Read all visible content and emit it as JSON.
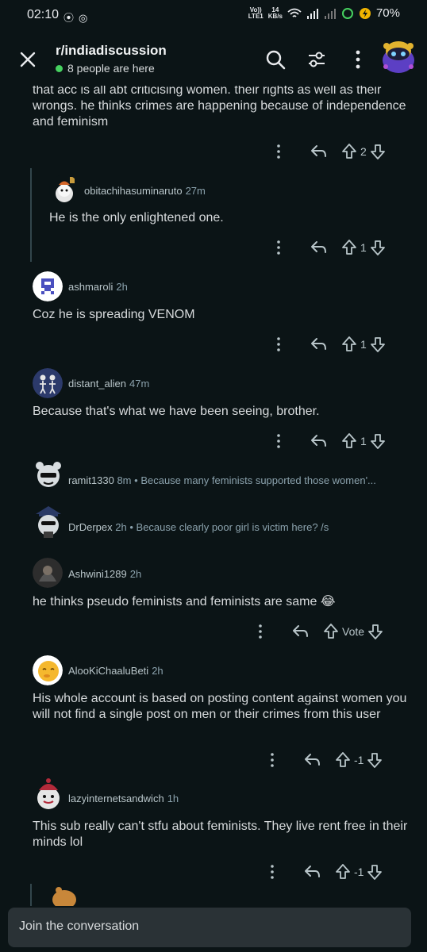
{
  "status_bar": {
    "time": "02:10",
    "net_top": "Vo))",
    "net_bottom": "LTE1",
    "speed_top": "14",
    "speed_bottom": "KB/s",
    "battery": "70%"
  },
  "header": {
    "subreddit": "r/indiadiscussion",
    "online": "8 people are here"
  },
  "parent_snippet": {
    "text": "that acc is all abt criticising women. their rights as well as their wrongs. he thinks crimes are happening because of independence and feminism",
    "votes": "2"
  },
  "comments": [
    {
      "user": "obitachihasuminaruto",
      "age": "27m",
      "text": "He is the only enlightened one.",
      "votes": "1"
    },
    {
      "user": "ashmaroli",
      "age": "2h",
      "text": "Coz he is spreading VENOM",
      "votes": "1"
    },
    {
      "user": "distant_alien",
      "age": "47m",
      "text": "Because that's what we have been seeing, brother.",
      "votes": "1"
    },
    {
      "user": "ramit1330",
      "age": "8m",
      "snippet": "Because many feminists supported those women'..."
    },
    {
      "user": "DrDerpex",
      "age": "2h",
      "snippet": "Because clearly poor girl is victim here? /s"
    },
    {
      "user": "Ashwini1289",
      "age": "2h",
      "text": "he thinks pseudo feminists and feminists are same 😂",
      "votes": "Vote"
    },
    {
      "user": "AlooKiChaaluBeti",
      "age": "2h",
      "text": "His whole account is based on posting content against women you will not find a single post on men or their crimes from this user",
      "votes": "-1"
    },
    {
      "user": "lazyinternetsandwich",
      "age": "1h",
      "text": "This sub really can't stfu about feminists. They live rent free in their minds lol",
      "votes": "-1"
    }
  ],
  "separator": "•",
  "join": {
    "placeholder": "Join the conversation"
  },
  "colors": {
    "background": "#0b1416",
    "text": "#d7dadc",
    "muted": "#8ba2ad",
    "online_dot": "#46d160",
    "input_bg": "#2a3236"
  }
}
